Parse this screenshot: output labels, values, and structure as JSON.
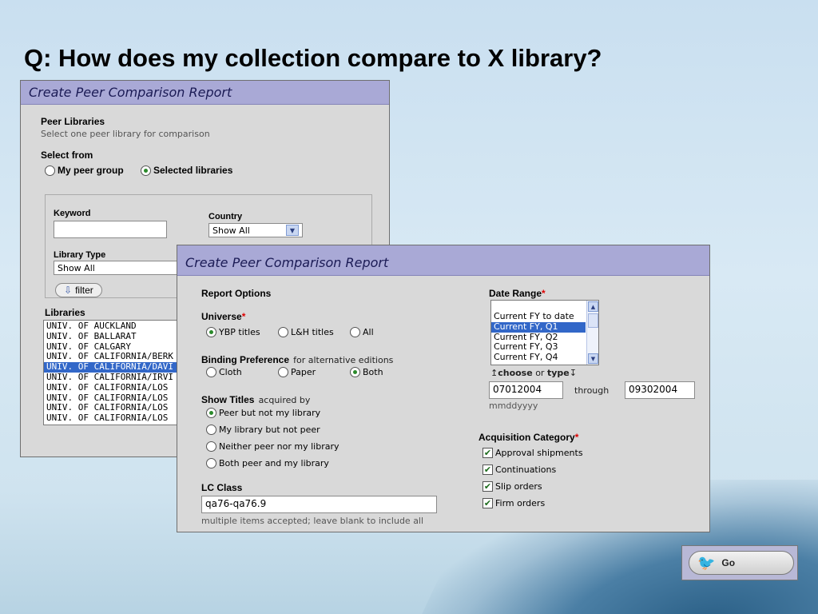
{
  "slide": {
    "title": "Q: How does my collection compare to X library?"
  },
  "back_window": {
    "title": "Create Peer Comparison Report",
    "peer_libraries_heading": "Peer Libraries",
    "peer_libraries_hint": "Select one peer library for comparison",
    "select_from_label": "Select from",
    "select_from_options": [
      {
        "label": "My peer group",
        "selected": false
      },
      {
        "label": "Selected libraries",
        "selected": true
      }
    ],
    "keyword_label": "Keyword",
    "keyword_value": "",
    "country_label": "Country",
    "country_value": "Show All",
    "library_type_label": "Library Type",
    "library_type_value": "Show All",
    "filter_label": "filter",
    "libraries_label": "Libraries",
    "libraries": [
      {
        "name": "UNIV. OF AUCKLAND",
        "selected": false
      },
      {
        "name": "UNIV. OF BALLARAT",
        "selected": false
      },
      {
        "name": "UNIV. OF CALGARY",
        "selected": false
      },
      {
        "name": "UNIV. OF CALIFORNIA/BERK",
        "selected": false
      },
      {
        "name": "UNIV. OF CALIFORNIA/DAVI",
        "selected": true
      },
      {
        "name": "UNIV. OF CALIFORNIA/IRVI",
        "selected": false
      },
      {
        "name": "UNIV. OF CALIFORNIA/LOS",
        "selected": false
      },
      {
        "name": "UNIV. OF CALIFORNIA/LOS",
        "selected": false
      },
      {
        "name": "UNIV. OF CALIFORNIA/LOS",
        "selected": false
      },
      {
        "name": "UNIV. OF CALIFORNIA/LOS",
        "selected": false
      }
    ]
  },
  "front_window": {
    "title": "Create Peer Comparison Report",
    "report_options_heading": "Report Options",
    "universe_label": "Universe",
    "required_mark": "*",
    "universe_options": [
      {
        "label": "YBP titles",
        "selected": true
      },
      {
        "label": "L&H titles",
        "selected": false
      },
      {
        "label": "All",
        "selected": false
      }
    ],
    "binding_label": "Binding Preference",
    "binding_sub": "for alternative editions",
    "binding_options": [
      {
        "label": "Cloth",
        "selected": false
      },
      {
        "label": "Paper",
        "selected": false
      },
      {
        "label": "Both",
        "selected": true
      }
    ],
    "show_titles_label": "Show Titles",
    "show_titles_sub": "acquired by",
    "show_titles_options": [
      {
        "label": "Peer but not my library",
        "selected": true
      },
      {
        "label": "My library but not peer",
        "selected": false
      },
      {
        "label": "Neither peer nor my library",
        "selected": false
      },
      {
        "label": "Both peer and my library",
        "selected": false
      }
    ],
    "lc_class_label": "LC Class",
    "lc_class_value": "qa76-qa76.9",
    "lc_class_hint": "multiple items accepted; leave blank to include all",
    "date_range_label": "Date Range",
    "date_range_options": [
      {
        "label": "Current FY to date",
        "selected": false
      },
      {
        "label": "Current FY, Q1",
        "selected": true
      },
      {
        "label": "Current FY, Q2",
        "selected": false
      },
      {
        "label": "Current FY, Q3",
        "selected": false
      },
      {
        "label": "Current FY, Q4",
        "selected": false
      }
    ],
    "choose_label": "choose",
    "or_label": "or",
    "type_label": "type",
    "date_from": "07012004",
    "through_label": "through",
    "date_to": "09302004",
    "date_format_hint": "mmddyyyy",
    "acq_label": "Acquisition Category",
    "acq_options": [
      {
        "label": "Approval shipments",
        "checked": true
      },
      {
        "label": "Continuations",
        "checked": true
      },
      {
        "label": "Slip orders",
        "checked": true
      },
      {
        "label": "Firm orders",
        "checked": true
      }
    ]
  },
  "go_button": {
    "label": "Go"
  }
}
